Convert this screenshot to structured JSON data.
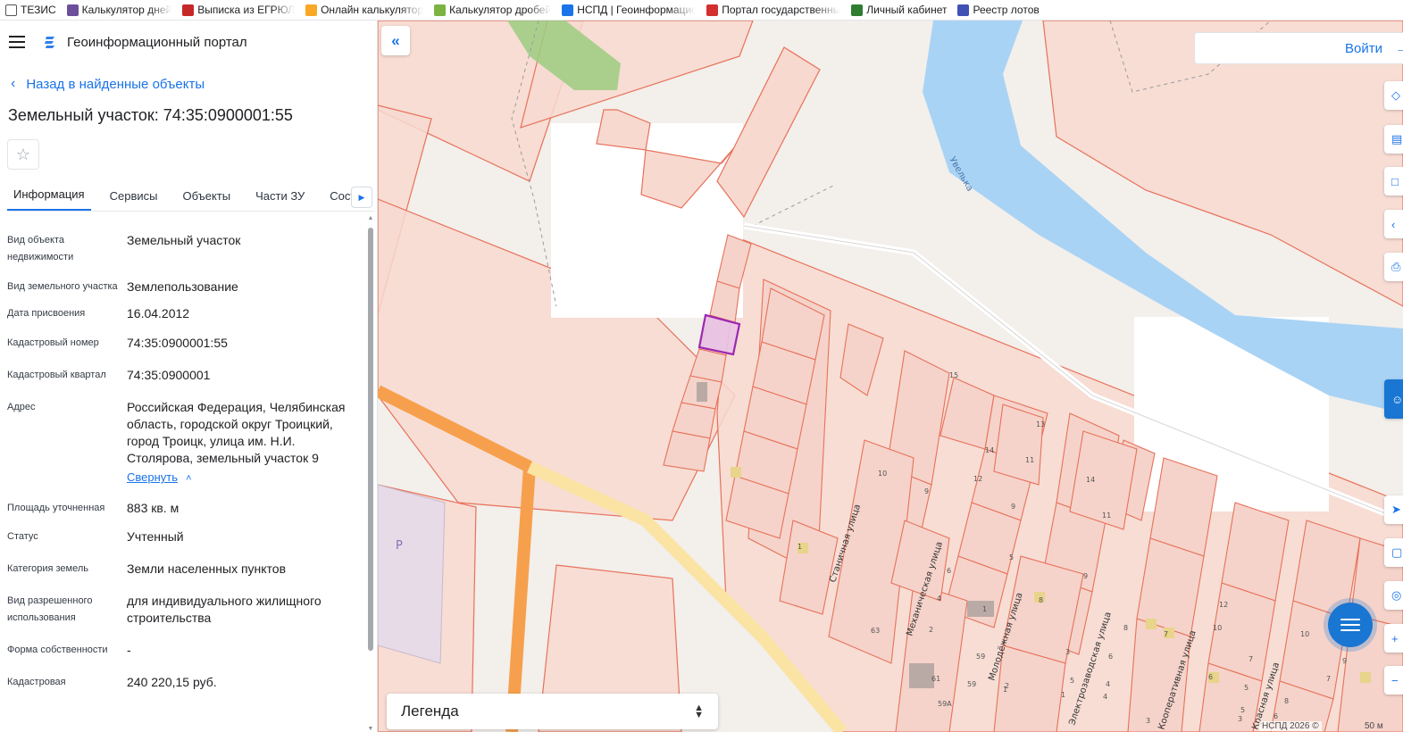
{
  "bookmarks": [
    {
      "label": "ТЕЗИС",
      "icon": "document-icon",
      "color": "#ffffff"
    },
    {
      "label": "Калькулятор дней",
      "icon": "calculator-icon",
      "color": "#6b4f9b"
    },
    {
      "label": "Выписка из ЕГРЮЛ",
      "icon": "b-logo-icon",
      "color": "#c62828"
    },
    {
      "label": "Онлайн калькулятор",
      "icon": "pencil-icon",
      "color": "#f9a825"
    },
    {
      "label": "Калькулятор дробей",
      "icon": "grid-icon",
      "color": "#7cb342"
    },
    {
      "label": "НСПД | Геоинформационный",
      "icon": "nspd-icon",
      "color": "#1a73e8"
    },
    {
      "label": "Портал государственных",
      "icon": "flag-icon",
      "color": "#d32f2f"
    },
    {
      "label": "Личный кабинет",
      "icon": "check-icon",
      "color": "#2e7d32"
    },
    {
      "label": "Реестр лотов",
      "icon": "emblem-icon",
      "color": "#3f51b5"
    }
  ],
  "app": {
    "title": "Геоинформационный портал"
  },
  "nav": {
    "back_label": "Назад в найденные объекты"
  },
  "object": {
    "title": "Земельный участок: 74:35:0900001:55"
  },
  "tabs": [
    {
      "label": "Информация",
      "active": true
    },
    {
      "label": "Сервисы",
      "active": false
    },
    {
      "label": "Объекты",
      "active": false
    },
    {
      "label": "Части ЗУ",
      "active": false
    },
    {
      "label": "Состав",
      "active": false
    }
  ],
  "info_rows": [
    {
      "label": "Вид объекта недвижимости",
      "value": "Земельный участок"
    },
    {
      "label": "Вид земельного участка",
      "value": "Землепользование"
    },
    {
      "label": "Дата присвоения",
      "value": "16.04.2012"
    },
    {
      "label": "Кадастровый номер",
      "value": "74:35:0900001:55"
    },
    {
      "label": "Кадастровый квартал",
      "value": "74:35:0900001"
    },
    {
      "label": "Адрес",
      "value": "Российская Федерация, Челябинская область, городской округ Троицкий, город Троицк, улица им. Н.И. Столярова, земельный участок 9",
      "action": "Свернуть"
    },
    {
      "label": "Площадь уточненная",
      "value": "883 кв. м"
    },
    {
      "label": "Статус",
      "value": "Учтенный"
    },
    {
      "label": "Категория земель",
      "value": "Земли населенных пунктов"
    },
    {
      "label": "Вид разрешенного использования",
      "value": "для индивидуального жилищного строительства"
    },
    {
      "label": "Форма собственности",
      "value": "-"
    },
    {
      "label": "Кадастровая",
      "value": "240 220,15 руб."
    }
  ],
  "map": {
    "login_label": "Войти",
    "legend_label": "Легенда",
    "attribution": "НСПД 2026 ©",
    "scale_label": "50 м",
    "labels": {
      "river": "Увелька",
      "street1": "Станичная улица",
      "street2": "Механическая улица",
      "street3": "Молодёжная улица",
      "street4": "Электрозаводская улица",
      "street5": "Кооперативная улица",
      "street6": "Красная улица",
      "parking": "P"
    },
    "house_numbers": [
      "13",
      "15",
      "14",
      "11",
      "12",
      "10",
      "9",
      "14",
      "11",
      "9",
      "1",
      "6",
      "4",
      "1",
      "2",
      "63",
      "8",
      "5",
      "3",
      "1",
      "4",
      "2",
      "59",
      "59",
      "61",
      "59А",
      "5",
      "8",
      "7",
      "3",
      "6",
      "10",
      "7",
      "12",
      "6",
      "5",
      "10",
      "9",
      "8",
      "7",
      "3",
      "6",
      "4",
      "1",
      "9",
      "5"
    ],
    "colors": {
      "parcel_fill": "#f7d9d0",
      "parcel_stroke": "#e8715a",
      "selected_stroke": "#9c27b0",
      "water": "#a9d3f5",
      "road_main": "#f6a04d",
      "road_secondary": "#fbe3a3",
      "vegetation": "#9ccc80"
    }
  }
}
